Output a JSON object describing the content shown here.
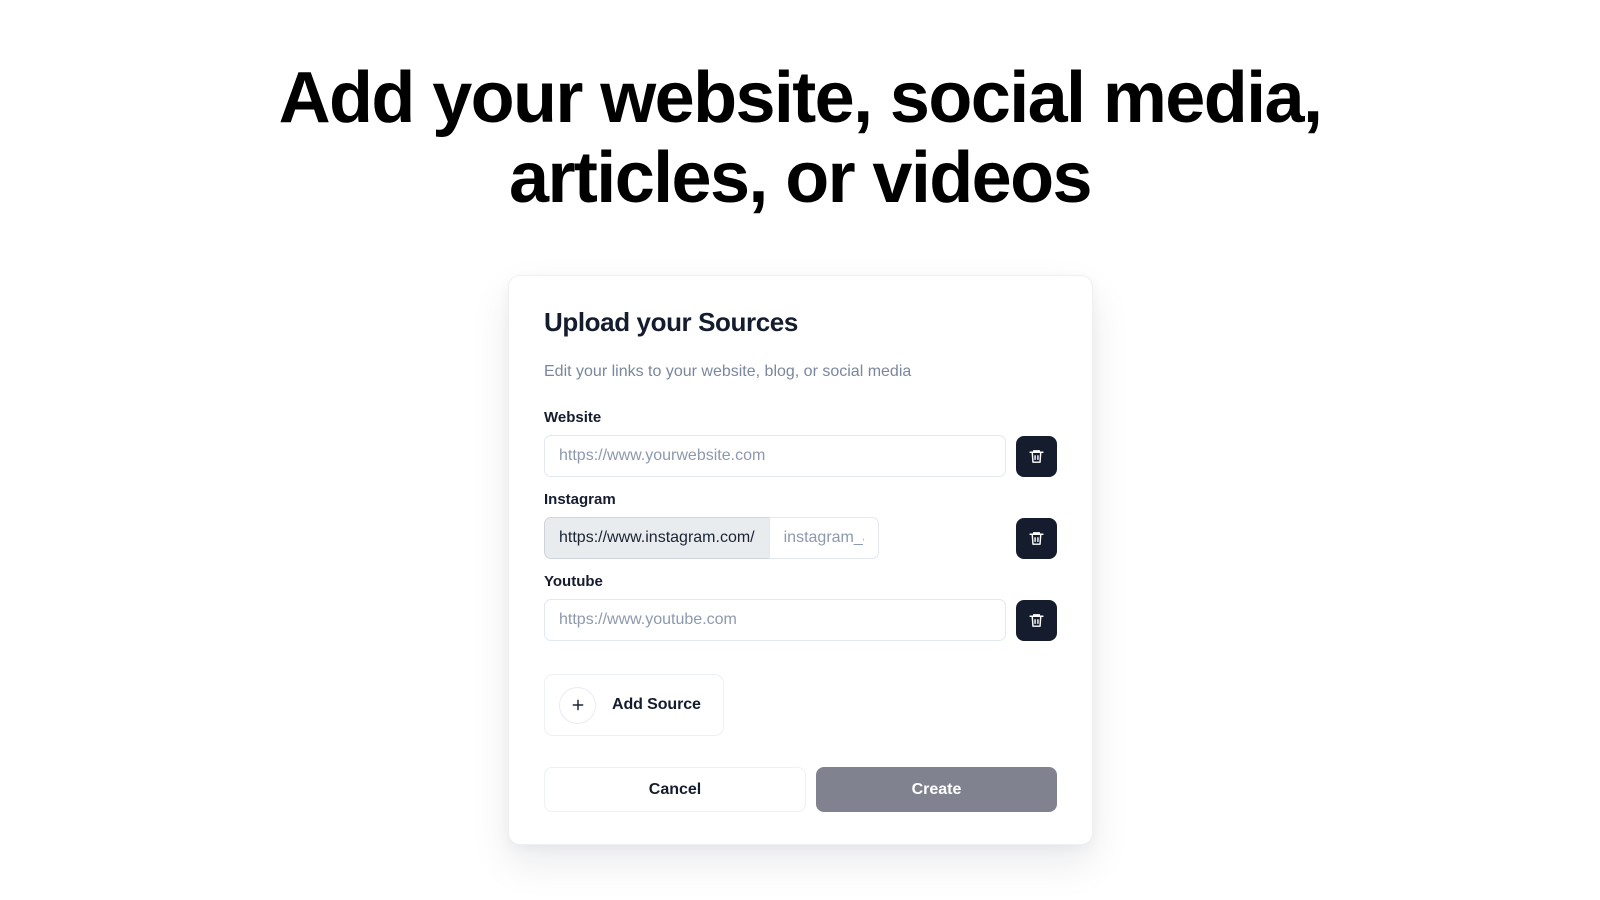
{
  "page": {
    "heading": "Add your website, social media, articles, or videos",
    "background_color": "#ffffff"
  },
  "card": {
    "title": "Upload your Sources",
    "subtitle": "Edit your links to your website, blog, or social media",
    "accent_dark": "#141c2e",
    "muted_text": "#7a879e",
    "fields": [
      {
        "label": "Website",
        "value": "",
        "placeholder": "https://www.yourwebsite.com",
        "prefix": null,
        "delete_icon": "trash-icon"
      },
      {
        "label": "Instagram",
        "value": "",
        "placeholder": "instagram_account",
        "prefix": "https://www.instagram.com/",
        "delete_icon": "trash-icon"
      },
      {
        "label": "Youtube",
        "value": "",
        "placeholder": "https://www.youtube.com",
        "prefix": null,
        "delete_icon": "trash-icon"
      }
    ],
    "add_source": {
      "label": "Add Source",
      "icon": "plus-icon"
    },
    "footer": {
      "cancel_label": "Cancel",
      "create_label": "Create",
      "create_color": "#80838f"
    }
  }
}
